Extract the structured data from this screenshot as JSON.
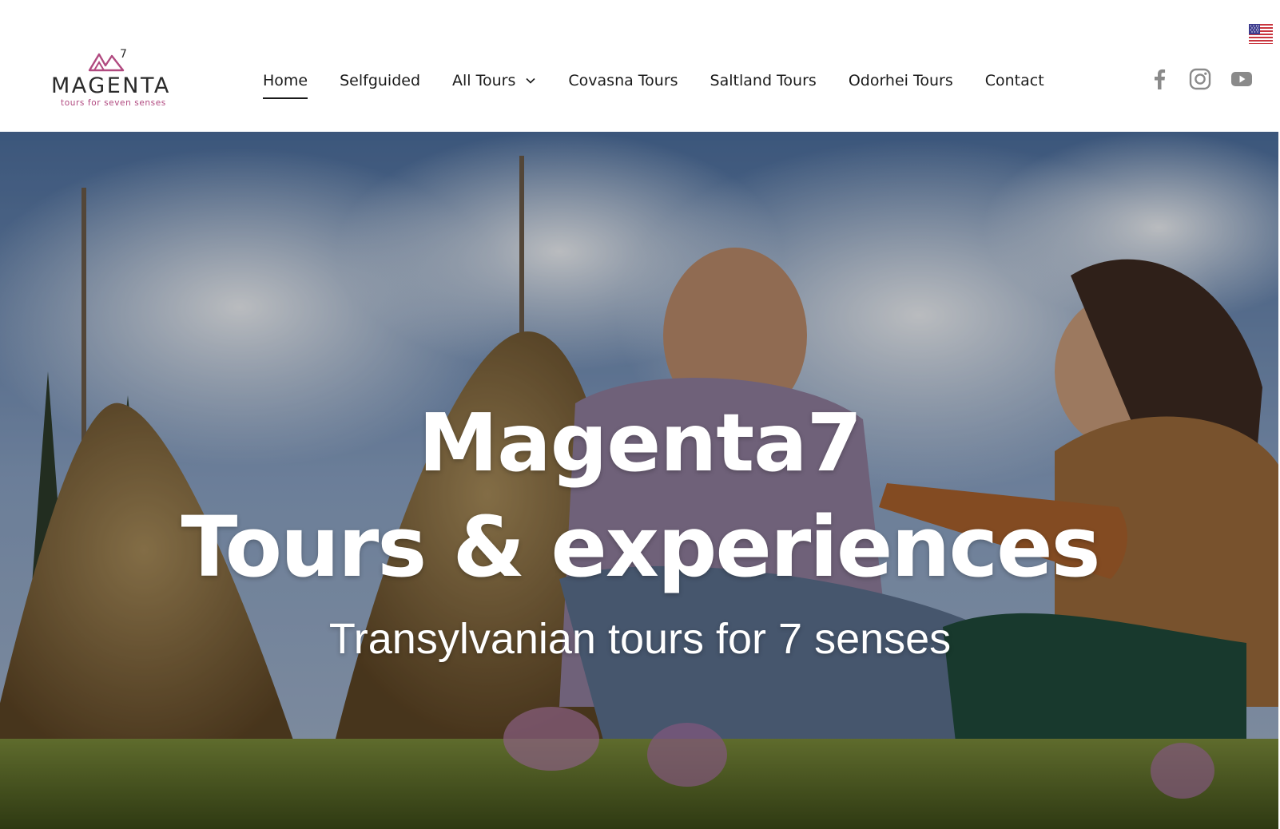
{
  "brand": {
    "wordmark": "MAGENTA",
    "tagline": "tours for seven senses",
    "mark": "7",
    "colors": {
      "accent": "#b14a80",
      "text": "#2a2a2a"
    }
  },
  "nav": {
    "items": [
      {
        "label": "Home",
        "active": true
      },
      {
        "label": "Selfguided",
        "active": false
      },
      {
        "label": "All Tours",
        "active": false,
        "dropdown": true
      },
      {
        "label": "Covasna Tours",
        "active": false
      },
      {
        "label": "Saltland Tours",
        "active": false
      },
      {
        "label": "Odorhei Tours",
        "active": false
      },
      {
        "label": "Contact",
        "active": false
      }
    ]
  },
  "language": {
    "flag": "us-flag-icon"
  },
  "social": [
    {
      "name": "facebook-icon"
    },
    {
      "name": "instagram-icon"
    },
    {
      "name": "youtube-icon"
    }
  ],
  "hero": {
    "title_line1": "Magenta7",
    "title_line2": "Tours & experiences",
    "subtitle": "Transylvanian tours for 7 senses"
  }
}
